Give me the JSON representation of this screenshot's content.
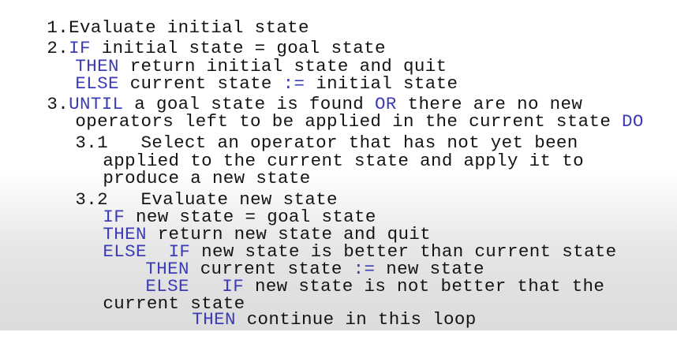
{
  "colors": {
    "text": "#141414",
    "keyword": "#3c3cb4"
  },
  "step1": {
    "num": "1.",
    "text": "Evaluate initial state"
  },
  "step2": {
    "num": "2.",
    "if_kw": "IF",
    "if_text": " initial state = goal state",
    "then_kw": "THEN",
    "then_text": " return initial state and quit",
    "else_kw": "ELSE",
    "else_text": " current state ",
    "assign": ":=",
    "else_text2": " initial state"
  },
  "step3": {
    "num": "3.",
    "until_kw": "UNTIL",
    "until_text": " a goal state is found ",
    "or_kw": "OR",
    "until_text2": " there are no new",
    "line2_text": "operators left to be applied in the current state ",
    "do_kw": "DO"
  },
  "step31": {
    "num": "3.1",
    "line1": "   Select an operator that has not yet been",
    "line2": "applied to the current state and apply it to",
    "line3": "produce a new state"
  },
  "step32": {
    "num": "3.2",
    "line1": "   Evaluate new state",
    "if_kw": "IF",
    "if_text": " new state = goal state",
    "then_kw": "THEN",
    "then_text": " return new state and quit",
    "else_kw": "ELSE",
    "else_gap": "  ",
    "else_if_kw": "IF",
    "else_if_text": " new state is better than current state",
    "then2_kw": "THEN",
    "then2_text": " current state ",
    "assign": ":=",
    "then2_text2": " new state",
    "else2_kw": "ELSE",
    "else2_gap": "   ",
    "else2_if_kw": "IF",
    "else2_if_text": " new state is not better that the",
    "cont_text": "current state",
    "then3_kw": "THEN",
    "then3_text": " continue in this loop"
  }
}
